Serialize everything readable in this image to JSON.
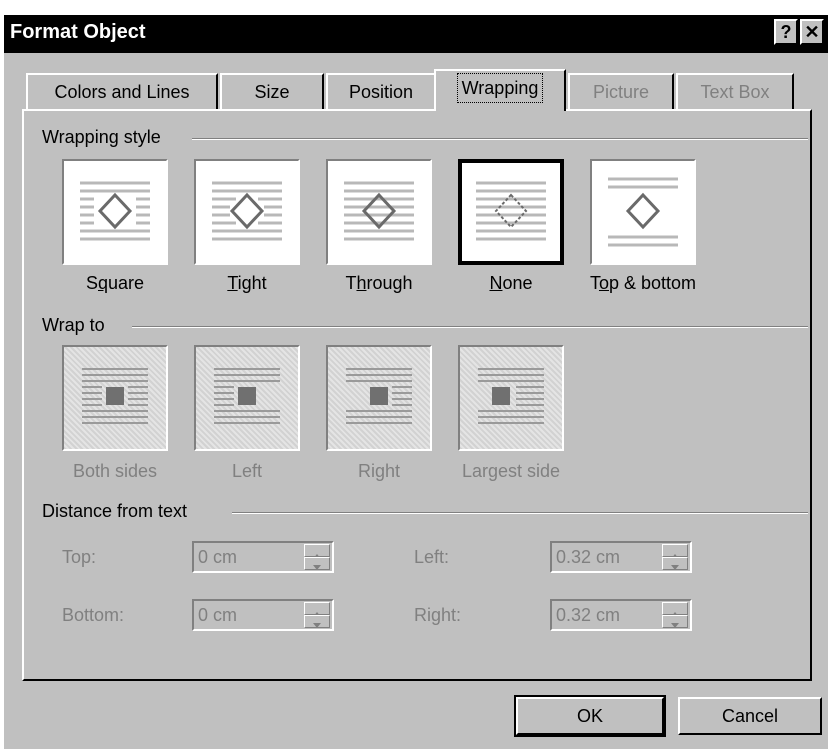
{
  "window": {
    "title": "Format Object",
    "help_glyph": "?",
    "close_glyph": "✕"
  },
  "tabs": [
    {
      "label": "Colors and Lines",
      "state": "enabled"
    },
    {
      "label": "Size",
      "state": "enabled"
    },
    {
      "label": "Position",
      "state": "enabled"
    },
    {
      "label": "Wrapping",
      "state": "selected"
    },
    {
      "label": "Picture",
      "state": "disabled"
    },
    {
      "label": "Text Box",
      "state": "disabled"
    }
  ],
  "wrapping_style": {
    "heading": "Wrapping style",
    "options": [
      {
        "label": "Square",
        "mnemonic_index": 1,
        "icon": "wrap-square-icon"
      },
      {
        "label": "Tight",
        "mnemonic_index": 0,
        "icon": "wrap-tight-icon"
      },
      {
        "label": "Through",
        "mnemonic_index": 1,
        "icon": "wrap-through-icon"
      },
      {
        "label": "None",
        "mnemonic_index": 0,
        "icon": "wrap-none-icon",
        "selected": true
      },
      {
        "label": "Top & bottom",
        "mnemonic_index": 1,
        "icon": "wrap-top-bottom-icon"
      }
    ]
  },
  "wrap_to": {
    "heading": "Wrap to",
    "disabled": true,
    "options": [
      {
        "label": "Both sides",
        "icon": "wrap-both-sides-icon"
      },
      {
        "label": "Left",
        "icon": "wrap-left-icon"
      },
      {
        "label": "Right",
        "icon": "wrap-right-icon"
      },
      {
        "label": "Largest side",
        "icon": "wrap-largest-side-icon"
      }
    ]
  },
  "distance": {
    "heading": "Distance from text",
    "disabled": true,
    "top": {
      "label": "Top:",
      "value": "0 cm"
    },
    "bottom": {
      "label": "Bottom:",
      "value": "0 cm"
    },
    "left": {
      "label": "Left:",
      "value": "0.32 cm"
    },
    "right": {
      "label": "Right:",
      "value": "0.32 cm"
    }
  },
  "buttons": {
    "ok": "OK",
    "cancel": "Cancel"
  },
  "colors": {
    "face": "#c0c0c0",
    "shadow": "#808080",
    "highlight": "#ffffff",
    "disabled_text": "#808080",
    "lines": "#b8b8b8"
  }
}
